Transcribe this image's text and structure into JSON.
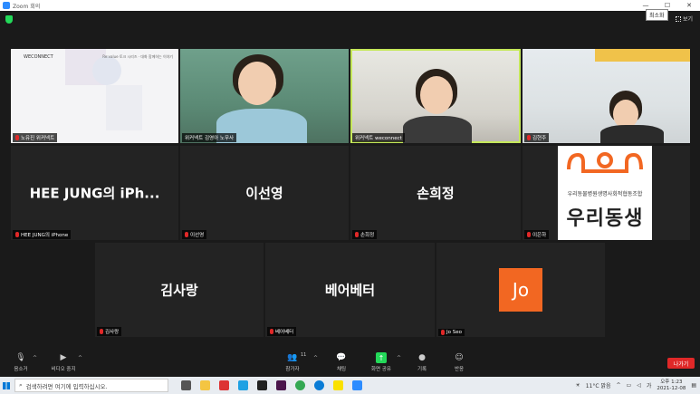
{
  "window": {
    "title": "Zoom 회의",
    "tooltip": "최소화"
  },
  "top": {
    "view_label": "보기"
  },
  "tiles": [
    {
      "name": "노유진 위커넥트",
      "logo": "WECONNECT",
      "header": "Re:value 토크 시리즈 · 대화 함께하는 이야기"
    },
    {
      "name": "위커넥트 김영아 노무사"
    },
    {
      "name": "위커넥트 weconnect"
    },
    {
      "name": "김현주"
    },
    {
      "display": "HEE JUNG의 iPh...",
      "name": "HEE JUNG의 iPhone"
    },
    {
      "display": "이선영",
      "name": "이선영"
    },
    {
      "display": "손희정",
      "name": "손희정"
    },
    {
      "name": "이은하",
      "org_small": "우리동물병원생명사회적협동조합",
      "org_main": "우리동생"
    },
    {
      "display": "김사랑",
      "name": "김사랑"
    },
    {
      "display": "베어베터",
      "name": "베어베터"
    },
    {
      "avatar": "Jo",
      "name": "Jo Seo"
    }
  ],
  "toolbar": {
    "mute": "음소거",
    "video": "비디오 중지",
    "participants": "참가자",
    "participants_count": "11",
    "chat": "채팅",
    "share": "화면 공유",
    "record": "기록",
    "reactions": "반응",
    "leave": "나가기"
  },
  "taskbar": {
    "search_placeholder": "검색하려면 여기에 입력하십시오.",
    "weather": "11°C 맑음",
    "lang": "가",
    "time": "오후 1:23",
    "date": "2021-12-08"
  },
  "colors": {
    "active_border": "#c5e85a",
    "zoom_blue": "#2d8cff",
    "leave_red": "#e02828",
    "jo_orange": "#f26722"
  }
}
